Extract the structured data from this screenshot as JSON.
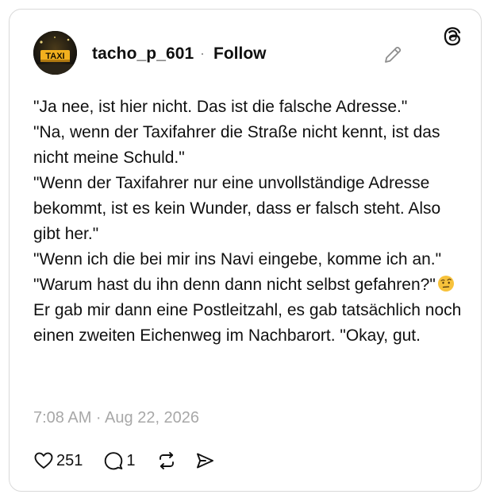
{
  "post": {
    "author": {
      "username": "tacho_p_601",
      "separator": "·",
      "follow_label": "Follow",
      "avatar_sign_text": "TAXI"
    },
    "text_paragraphs": [
      "\"Ja nee, ist hier nicht. Das ist die falsche Adresse.\"",
      "\"Na, wenn der Taxifahrer die Straße nicht kennt, ist das nicht meine Schuld.\"",
      "\"Wenn der Taxifahrer nur eine unvollständige Adresse bekommt, ist es kein Wunder, dass er falsch steht. Also gibt her.\"",
      "\"Wenn ich die bei mir ins Navi eingebe, komme ich an.\""
    ],
    "last_paragraph_before_emoji": "\"Warum hast du ihn denn dann nicht selbst gefahren?\"",
    "last_paragraph_after_emoji": "Er gab mir dann eine Postleitzahl, es gab tatsächlich noch einen zweiten Eichenweg im Nachbarort. \"Okay, gut.",
    "emoji_name": "face-with-raised-eyebrow-emoji",
    "timestamp": "7:08 AM · Aug 22, 2026",
    "likes_count": "251",
    "replies_count": "1"
  },
  "icons": {
    "logo": "threads-logo-icon",
    "edit": "pencil-icon",
    "like": "heart-icon",
    "reply": "comment-icon",
    "repost": "repost-icon",
    "share": "send-icon"
  },
  "colors": {
    "text": "#101010",
    "muted": "#a8a8a8",
    "border": "#d9d9d9",
    "sign_yellow": "#f2b01e"
  }
}
